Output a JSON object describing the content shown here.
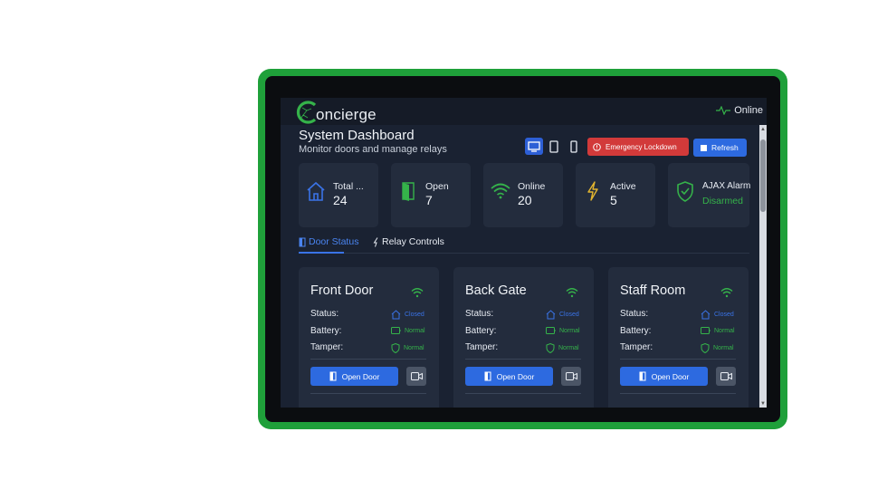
{
  "app": {
    "logo_text": "oncierge",
    "connection_status": "Online"
  },
  "header": {
    "title": "System Dashboard",
    "subtitle": "Monitor doors and manage relays"
  },
  "actions": {
    "emergency_label": "Emergency Lockdown",
    "refresh_label": "Refresh"
  },
  "stats": [
    {
      "label": "Total ...",
      "value": "24",
      "icon": "house-icon",
      "color": "#3a73e6"
    },
    {
      "label": "Open",
      "value": "7",
      "icon": "open-door-icon",
      "color": "#35b34a"
    },
    {
      "label": "Online",
      "value": "20",
      "icon": "wifi-icon",
      "color": "#35b34a"
    },
    {
      "label": "Active",
      "value": "5",
      "icon": "lightning-icon",
      "color": "#e3b52f"
    },
    {
      "label": "AJAX Alarm",
      "value": "Disarmed",
      "icon": "shield-check-icon",
      "color": "#35b34a"
    }
  ],
  "tabs": [
    {
      "label": "Door Status",
      "active": true
    },
    {
      "label": "Relay Controls",
      "active": false
    }
  ],
  "doors": [
    {
      "name": "Front Door",
      "status_label": "Status:",
      "status": "Closed",
      "battery_label": "Battery:",
      "battery": "Normal",
      "tamper_label": "Tamper:",
      "tamper": "Normal",
      "open_label": "Open Door"
    },
    {
      "name": "Back Gate",
      "status_label": "Status:",
      "status": "Closed",
      "battery_label": "Battery:",
      "battery": "Normal",
      "tamper_label": "Tamper:",
      "tamper": "Normal",
      "open_label": "Open Door"
    },
    {
      "name": "Staff Room",
      "status_label": "Status:",
      "status": "Closed",
      "battery_label": "Battery:",
      "battery": "Normal",
      "tamper_label": "Tamper:",
      "tamper": "Normal",
      "open_label": "Open Door"
    }
  ],
  "colors": {
    "accent": "#2d6ae0",
    "danger": "#d23a3a",
    "success": "#35b34a",
    "bezel": "#1fa03a",
    "background": "#1a2232"
  }
}
